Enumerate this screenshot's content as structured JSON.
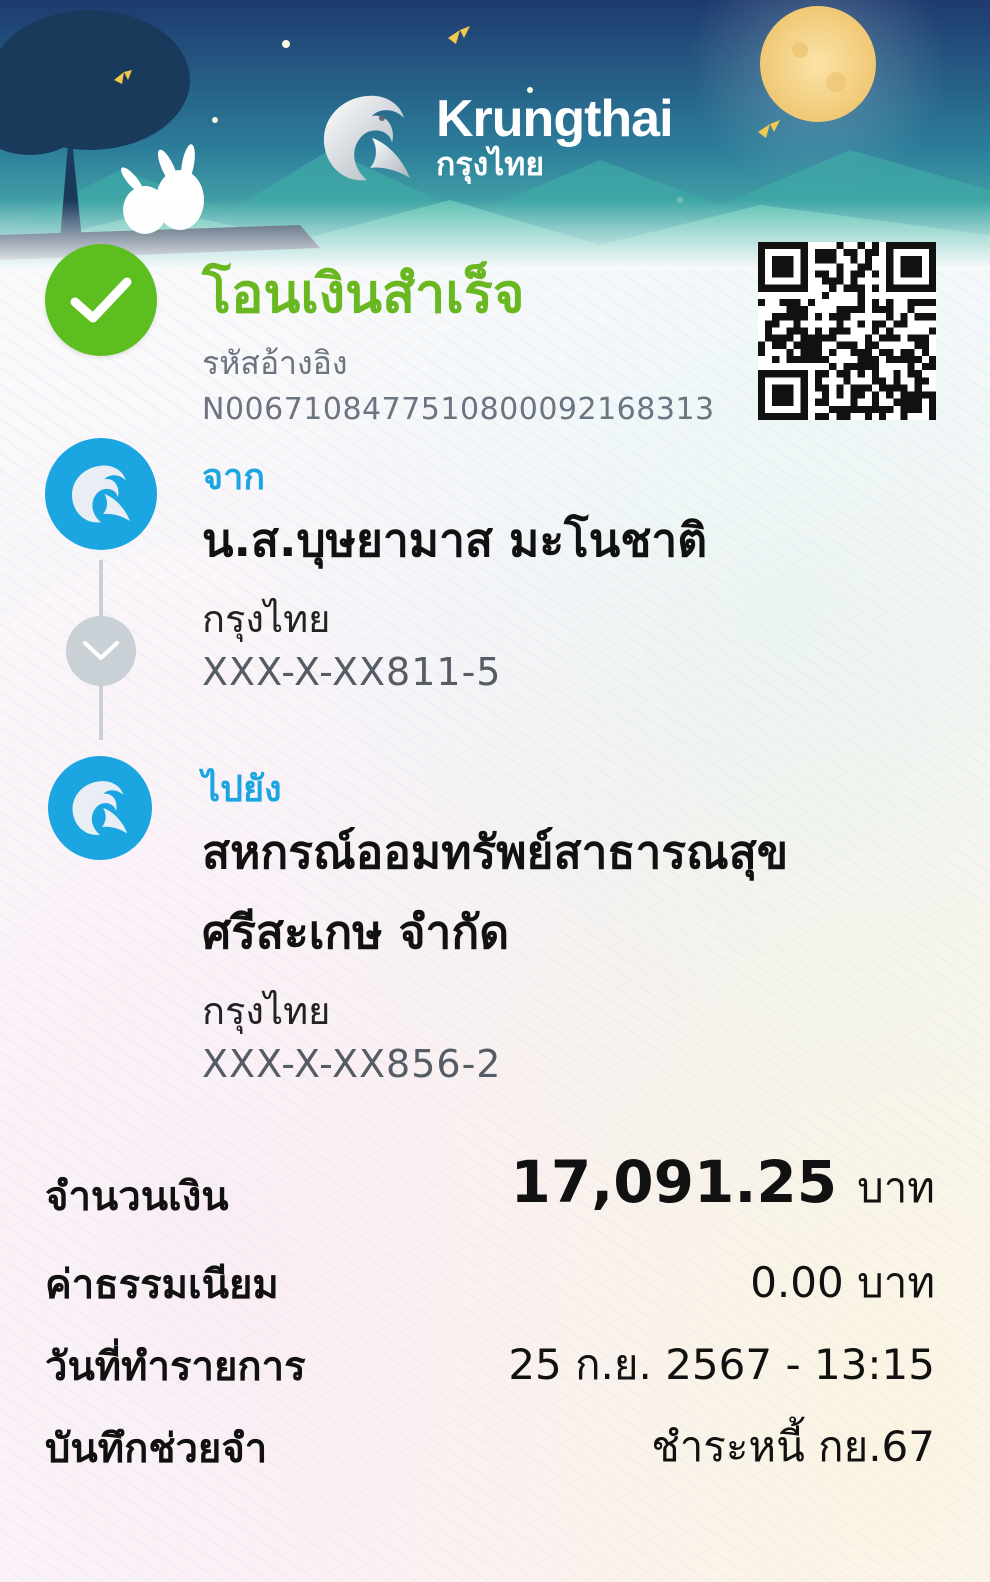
{
  "brand": {
    "name_en": "Krungthai",
    "name_th": "กรุงไทย",
    "colors": {
      "success": "#5cbf1f",
      "title_green": "#6ab821",
      "accent_blue": "#1ba5e1",
      "banner_teal": "#3fa8a5"
    }
  },
  "status": {
    "icon": "check-icon",
    "title": "โอนเงินสำเร็จ",
    "ref_label": "รหัสอ้างอิง",
    "ref_value": "N0067108477510800092168313"
  },
  "from": {
    "label": "จาก",
    "name": "น.ส.บุษยามาส มะโนชาติ",
    "bank": "กรุงไทย",
    "account": "XXX-X-XX811-5"
  },
  "to": {
    "label": "ไปยัง",
    "name_line1": "สหกรณ์ออมทรัพย์สาธารณสุข",
    "name_line2": "ศรีสะเกษ จำกัด",
    "bank": "กรุงไทย",
    "account": "XXX-X-XX856-2"
  },
  "summary": {
    "amount_label": "จำนวนเงิน",
    "amount_value": "17,091.25",
    "amount_unit": "บาท",
    "fee_label": "ค่าธรรมเนียม",
    "fee_value": "0.00 บาท",
    "date_label": "วันที่ทำรายการ",
    "date_value": "25 ก.ย. 2567 - 13:15",
    "memo_label": "บันทึกช่วยจำ",
    "memo_value": "ชำระหนี้ กย.67"
  }
}
